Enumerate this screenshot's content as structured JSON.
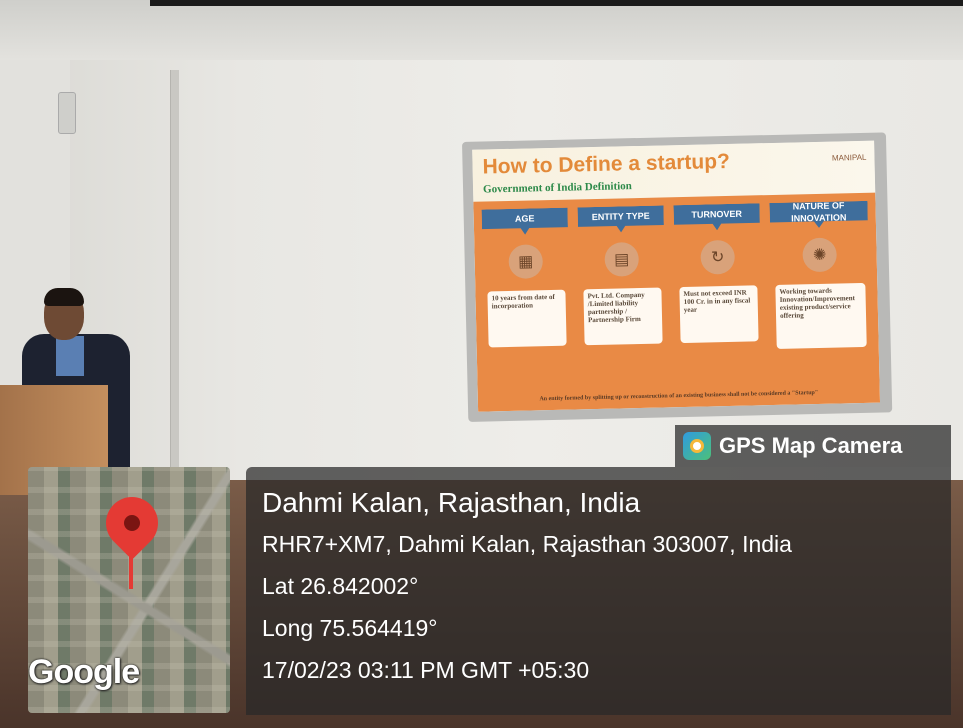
{
  "slide": {
    "title": "How to Define a startup?",
    "subtitle": "Government of India Definition",
    "logos": "MANIPAL",
    "columns": [
      {
        "tag": "AGE",
        "icon": "calendar-icon",
        "text": "10 years from date of incorporation"
      },
      {
        "tag": "ENTITY TYPE",
        "icon": "document-icon",
        "text": "Pvt. Ltd. Company /Limited liability partnership / Partnership Firm"
      },
      {
        "tag": "TURNOVER",
        "icon": "money-cycle-icon",
        "text": "Must not exceed INR 100 Cr. in in any fiscal year"
      },
      {
        "tag": "NATURE OF INNOVATION",
        "icon": "lightbulb-icon",
        "text": "Working towards Innovation/Improvement existing product/service offering"
      }
    ],
    "footnote": "An entity formed by splitting up or reconstruction of an existing business shall not be considered a \"Startup\""
  },
  "overlay": {
    "app_badge": "GPS Map Camera",
    "place": "Dahmi Kalan, Rajasthan, India",
    "address": "RHR7+XM7, Dahmi Kalan, Rajasthan 303007, India",
    "lat": "Lat 26.842002°",
    "long": "Long 75.564419°",
    "datetime": "17/02/23 03:11 PM GMT +05:30",
    "map_brand": "Google"
  },
  "colors": {
    "slide_orange": "#e98a45",
    "slide_tag_blue": "#3f6e9c",
    "title_orange": "#e38a3a",
    "subtitle_green": "#2e8a4a",
    "pin_red": "#e43a34"
  }
}
